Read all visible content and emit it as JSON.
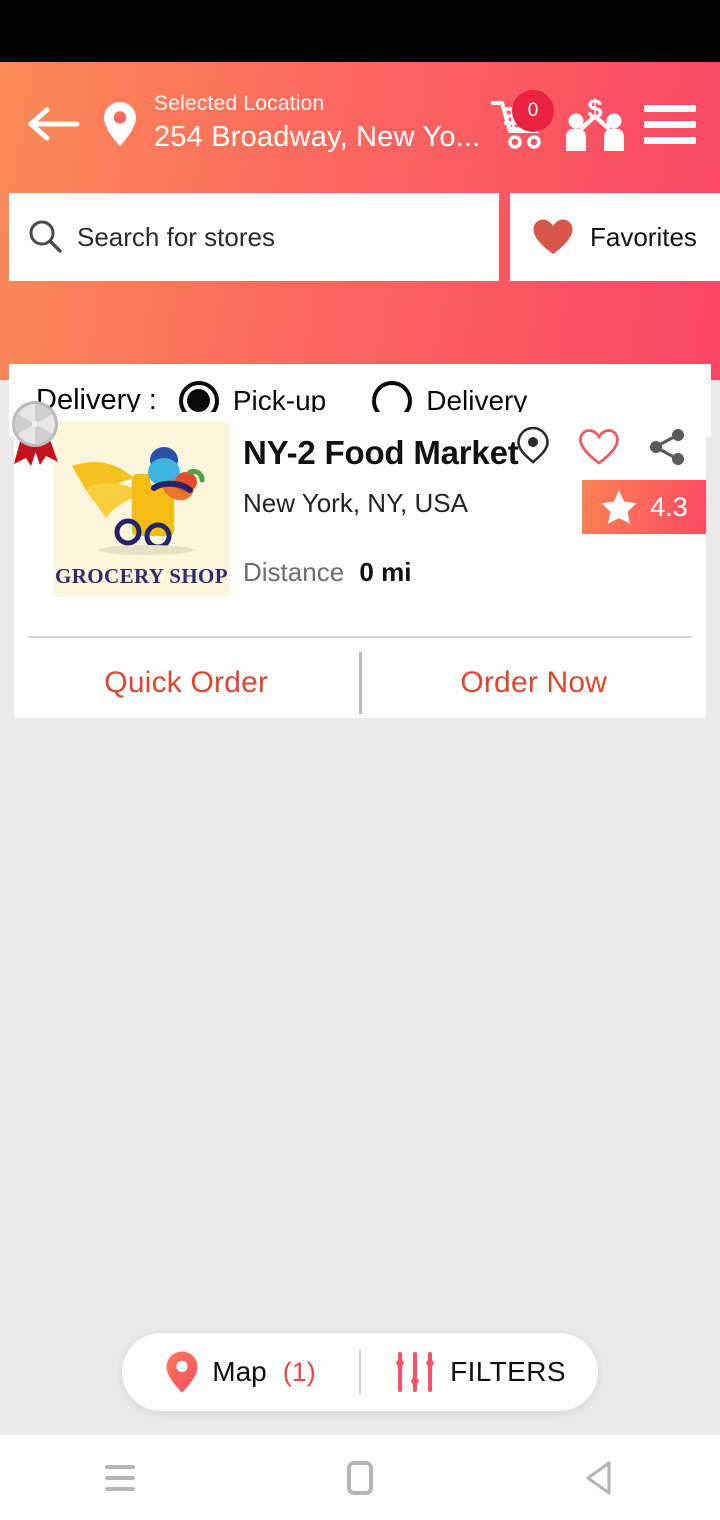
{
  "header": {
    "back_icon": "arrow-left-icon",
    "pin_icon": "location-pin-icon",
    "location_label": "Selected Location",
    "location_value": "254 Broadway, New Yo...",
    "cart_icon": "shopping-cart-icon",
    "cart_count": "0",
    "refer_icon": "refer-earn-people-dollar-icon",
    "menu_icon": "hamburger-menu-icon",
    "gradient_start": "#FB8B57",
    "gradient_end": "#FB4566"
  },
  "search": {
    "icon": "search-icon",
    "placeholder": "Search for stores",
    "value": "",
    "favorites_icon": "heart-filled-icon",
    "favorites_label": "Favorites",
    "favorites_icon_color": "#D9574A"
  },
  "delivery": {
    "title": "Delivery :",
    "options": [
      {
        "label": "Pick-up",
        "selected": true
      },
      {
        "label": "Delivery",
        "selected": false
      }
    ]
  },
  "store": {
    "badge_icon": "award-medal-icon",
    "logo_text": "GROCERY SHOP",
    "logo_alt": "grocery-scooter-logo",
    "name": "NY-2 Food Market",
    "address": "New York, NY, USA",
    "distance_label": "Distance",
    "distance_value": "0 mi",
    "icons": [
      {
        "name": "map-locate-icon"
      },
      {
        "name": "heart-outline-icon"
      },
      {
        "name": "share-icon"
      }
    ],
    "rating_icon": "star-icon",
    "rating": "4.3",
    "rating_bg_start": "#FC8254",
    "rating_bg_end": "#FB4A63",
    "actions": [
      {
        "label": "Quick Order",
        "name": "quick-order-button"
      },
      {
        "label": "Order Now",
        "name": "order-now-button"
      }
    ],
    "action_color": "#E0452E"
  },
  "bottom_bar": {
    "map_icon": "map-pin-icon",
    "map_label": "Map",
    "map_count": "(1)",
    "filters_icon": "filters-sliders-icon",
    "filters_label": "FILTERS"
  },
  "android_nav": {
    "recents_icon": "recents-icon",
    "home_icon": "home-square-icon",
    "back_icon": "back-triangle-icon"
  },
  "theme": {
    "page_background": "#EAEAEA",
    "card_background": "#FFFFFF"
  }
}
